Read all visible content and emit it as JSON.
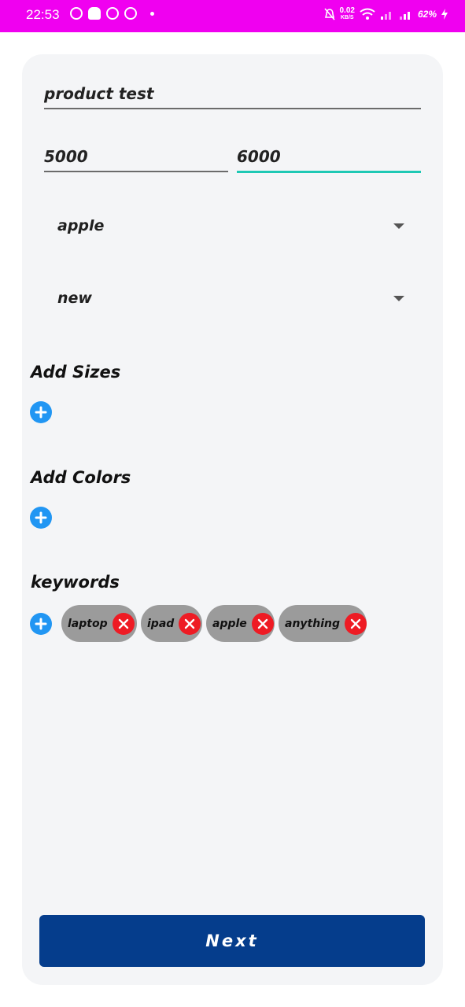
{
  "status_bar": {
    "time": "22:53",
    "speed_value": "0.02",
    "speed_unit": "KB/S",
    "battery": "62%",
    "app_icons": [
      "whatsapp-icon",
      "snapchat-icon",
      "messenger-icon",
      "pinterest-icon"
    ]
  },
  "form": {
    "name_value": "product test",
    "min_price_value": "5000",
    "max_price_value": "6000",
    "brand_selected": "apple",
    "condition_selected": "new"
  },
  "sections": {
    "sizes_title": "Add Sizes",
    "colors_title": "Add Colors",
    "keywords_title": "keywords"
  },
  "keywords": [
    "laptop",
    "ipad",
    "apple",
    "anything"
  ],
  "next_label": "Next",
  "colors": {
    "status_bar": "#f000f0",
    "card": "#f4f5f7",
    "add_button": "#2196f3",
    "chip": "#9b9b9b",
    "chip_remove": "#ee1b24",
    "active_underline": "#1ec8b4",
    "next_button": "#053d8c"
  }
}
